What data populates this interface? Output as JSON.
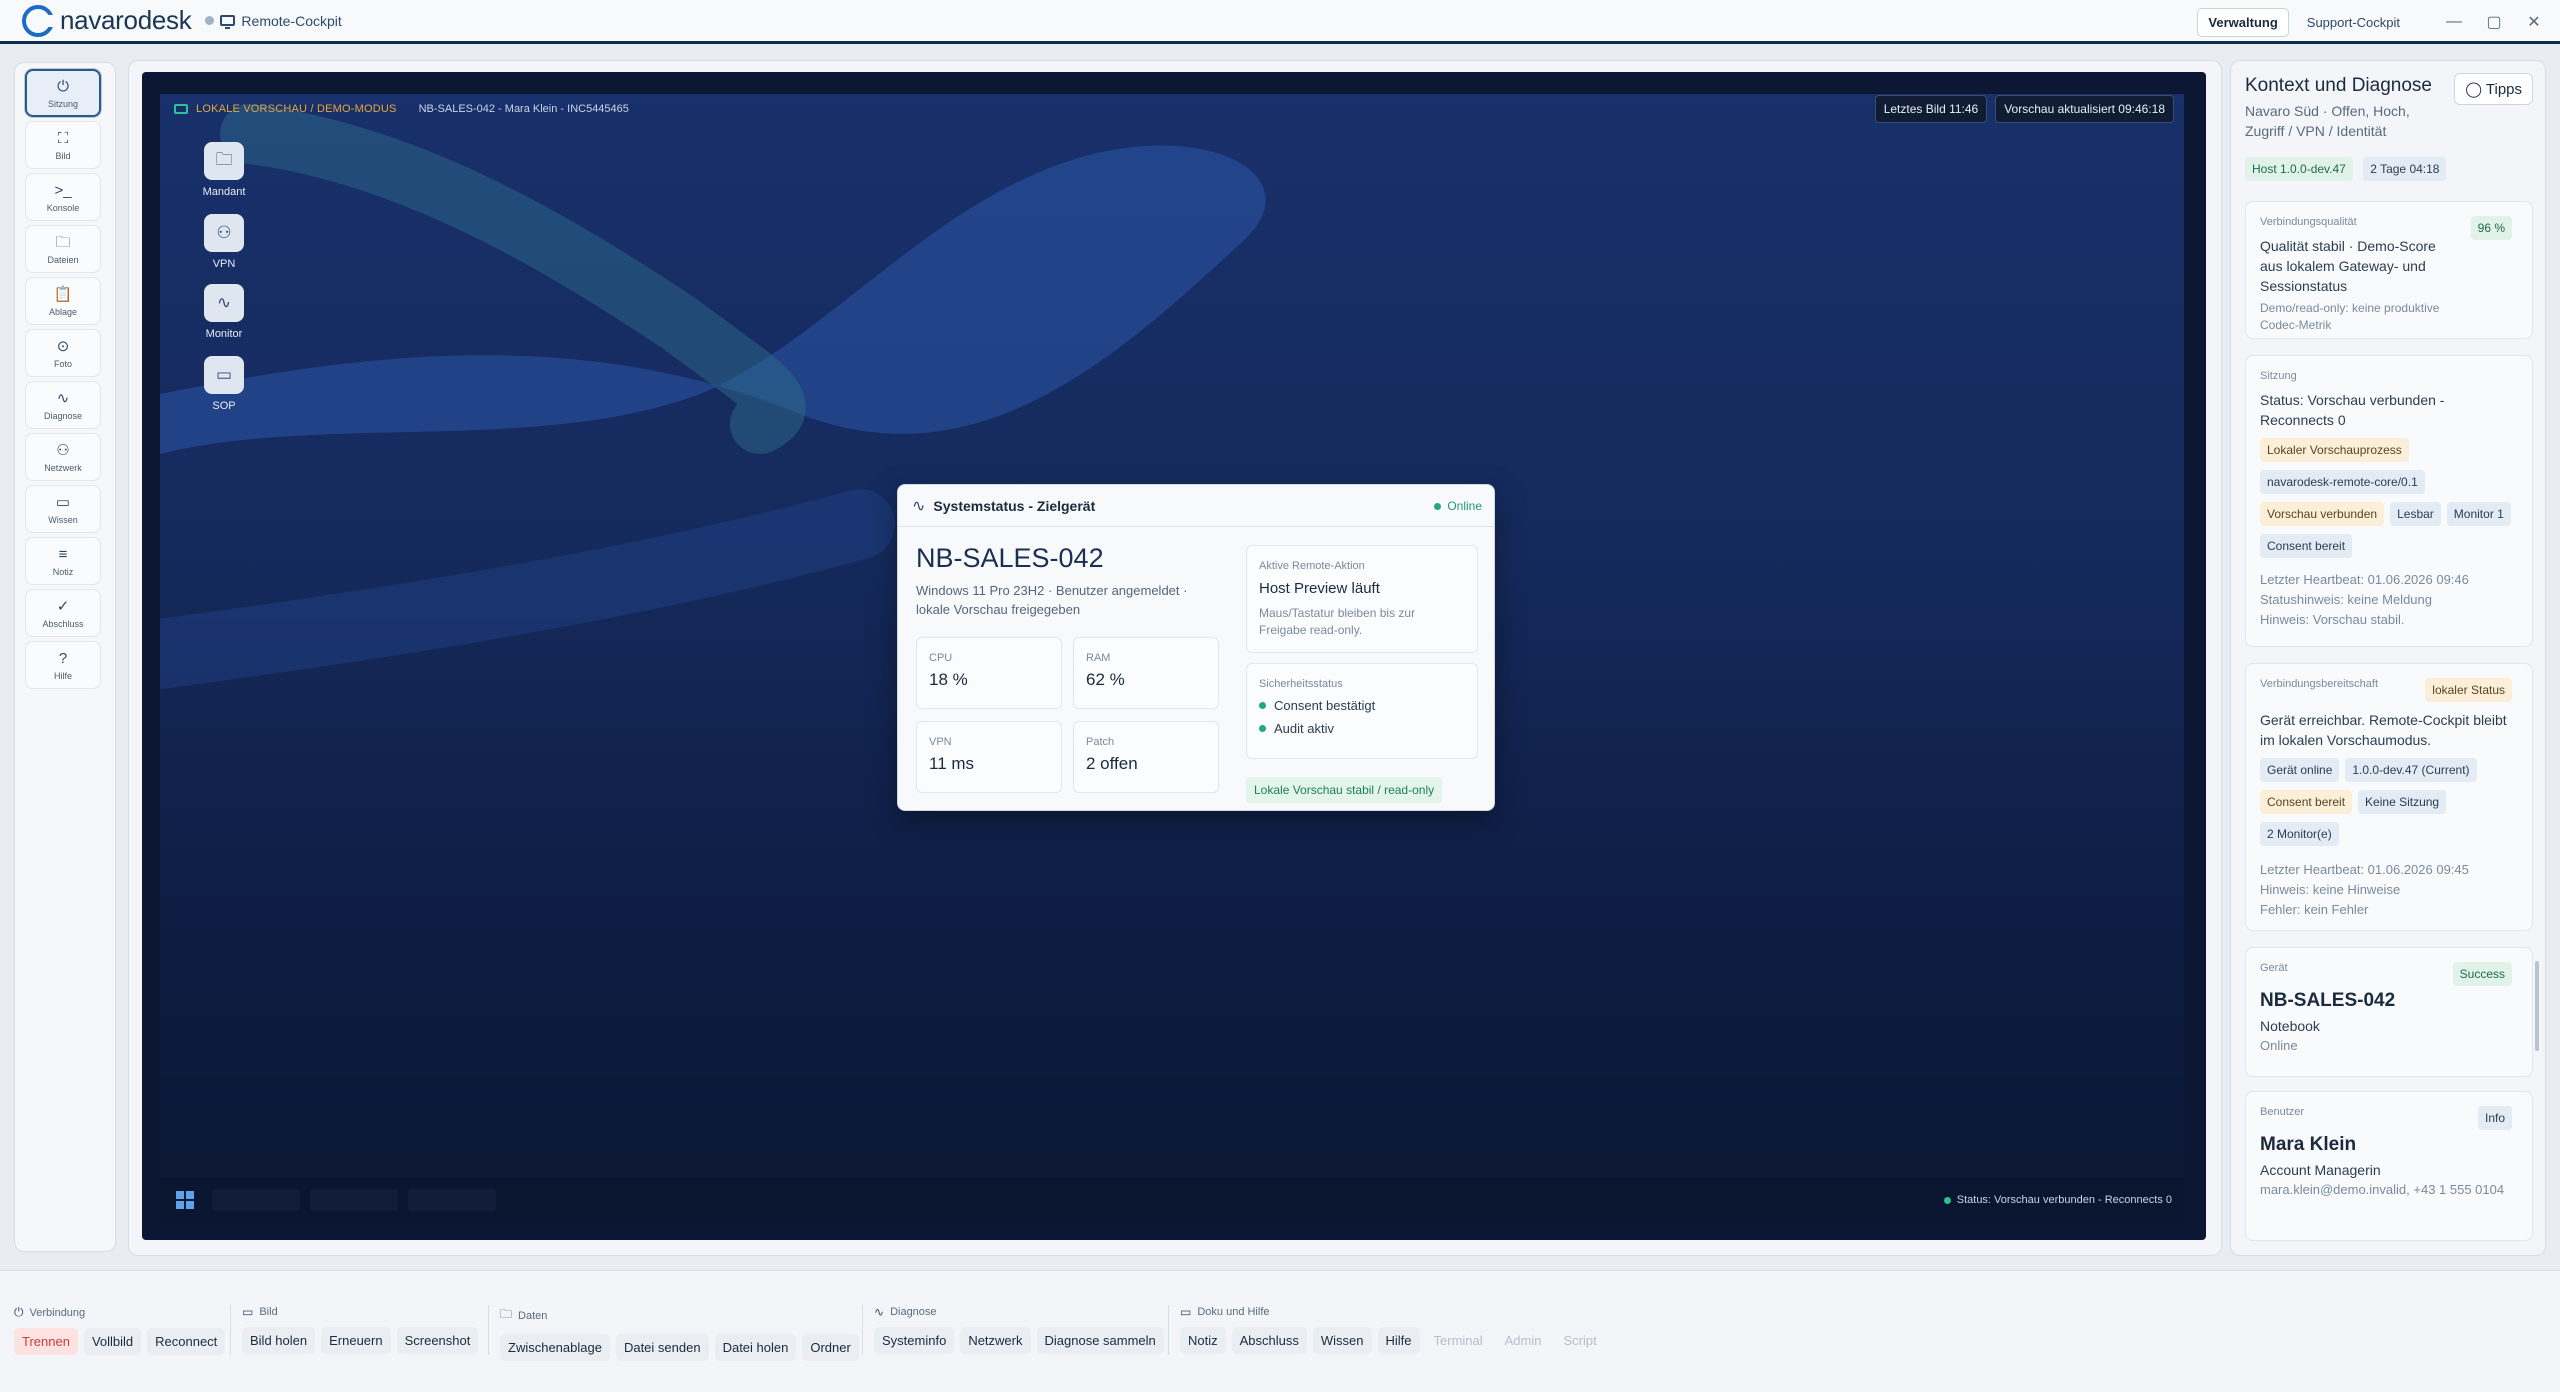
{
  "app": {
    "brand": "navarodesk",
    "mode": "Remote-Cockpit",
    "tabs": [
      "Verwaltung",
      "Support-Cockpit"
    ],
    "active_tab": "Verwaltung",
    "win": {
      "min": "—",
      "max": "▢",
      "close": "✕"
    }
  },
  "sidebar": [
    {
      "label": "Sitzung",
      "icon": "⏻",
      "name": "power-icon"
    },
    {
      "label": "Bild",
      "icon": "⛶",
      "name": "fullscreen-icon"
    },
    {
      "label": "Konsole",
      "icon": ">_",
      "name": "terminal-icon"
    },
    {
      "label": "Dateien",
      "icon": "🗀",
      "name": "folder-icon"
    },
    {
      "label": "Ablage",
      "icon": "📋",
      "name": "clipboard-icon"
    },
    {
      "label": "Foto",
      "icon": "⊙",
      "name": "camera-icon"
    },
    {
      "label": "Diagnose",
      "icon": "∿",
      "name": "activity-icon"
    },
    {
      "label": "Netzwerk",
      "icon": "⚇",
      "name": "network-icon"
    },
    {
      "label": "Wissen",
      "icon": "▭",
      "name": "book-icon"
    },
    {
      "label": "Notiz",
      "icon": "≡",
      "name": "note-icon"
    },
    {
      "label": "Abschluss",
      "icon": "✓",
      "name": "check-circle-icon"
    },
    {
      "label": "Hilfe",
      "icon": "?",
      "name": "help-icon"
    }
  ],
  "desk": {
    "demo_label": "LOKALE VORSCHAU / DEMO-MODUS",
    "session_id": "NB-SALES-042 - Mara Klein - INC5445465",
    "last_frame": "Letztes Bild 11:46",
    "updated": "Vorschau aktualisiert 09:46:18",
    "icons": [
      {
        "label": "Mandant",
        "icon": "🗀"
      },
      {
        "label": "VPN",
        "icon": "⚇"
      },
      {
        "label": "Monitor",
        "icon": "∿"
      },
      {
        "label": "SOP",
        "icon": "▭"
      }
    ],
    "taskbar_status": "Status: Vorschau verbunden - Reconnects 0"
  },
  "card": {
    "title": "Systemstatus - Zielgerät",
    "online": "Online",
    "device": "NB-SALES-042",
    "subtitle": "Windows 11 Pro 23H2 · Benutzer angemeldet · lokale Vorschau freigegeben",
    "metrics": [
      {
        "k": "CPU",
        "v": "18 %"
      },
      {
        "k": "RAM",
        "v": "62 %"
      },
      {
        "k": "VPN",
        "v": "11 ms"
      },
      {
        "k": "Patch",
        "v": "2 offen"
      }
    ],
    "action": {
      "k": "Aktive Remote-Aktion",
      "title": "Host Preview läuft",
      "note": "Maus/Tastatur bleiben bis zur Freigabe read-only."
    },
    "security": {
      "k": "Sicherheitsstatus",
      "items": [
        "Consent bestätigt",
        "Audit aktiv"
      ]
    },
    "stable": "Lokale Vorschau stabil / read-only"
  },
  "right": {
    "title": "Kontext und Diagnose",
    "tips": "Tipps",
    "sub": "Navaro Süd · Offen, Hoch, Zugriff / VPN / Identität",
    "top_chips": [
      "Host 1.0.0-dev.47",
      "2 Tage 04:18"
    ],
    "quality": {
      "k": "Verbindungsqualität",
      "badge": "96 %",
      "txt": "Qualität stabil · Demo-Score aus lokalem Gateway- und Sessionstatus",
      "muted": "Demo/read-only: keine produktive Codec-Metrik"
    },
    "session": {
      "k": "Sitzung",
      "txt": "Status: Vorschau verbunden - Reconnects 0",
      "chips": [
        [
          "Lokaler Vorschauprozess",
          "amber"
        ],
        [
          "navarodesk-remote-core/0.1",
          "blue"
        ],
        [
          "Vorschau verbunden",
          "amber"
        ],
        [
          "Lesbar",
          "blue"
        ],
        [
          "Monitor 1",
          "blue"
        ],
        [
          "Consent bereit",
          "blue"
        ]
      ],
      "lines": [
        "Letzter Heartbeat: 01.06.2026 09:46",
        "Statushinweis: keine Meldung",
        "Hinweis: Vorschau stabil."
      ]
    },
    "ready": {
      "k": "Verbindungsbereitschaft",
      "badge": "lokaler Status",
      "txt": "Gerät erreichbar. Remote-Cockpit bleibt im lokalen Vorschaumodus.",
      "chips": [
        [
          "Gerät online",
          "blue"
        ],
        [
          "1.0.0-dev.47 (Current)",
          "blue"
        ],
        [
          "Consent bereit",
          "amber"
        ],
        [
          "Keine Sitzung",
          "blue"
        ],
        [
          "2 Monitor(e)",
          "blue"
        ]
      ],
      "lines": [
        "Letzter Heartbeat: 01.06.2026 09:45",
        "Hinweis: keine Hinweise",
        "Fehler: kein Fehler"
      ]
    },
    "device": {
      "k": "Gerät",
      "badge": "Success",
      "name": "NB-SALES-042",
      "type": "Notebook",
      "status": "Online"
    },
    "user": {
      "k": "Benutzer",
      "badge": "Info",
      "name": "Mara Klein",
      "role": "Account Managerin",
      "contact": "mara.klein@demo.invalid, +43 1 555 0104"
    }
  },
  "bottom": [
    {
      "h": "Verbindung",
      "icon": "⏻",
      "btns": [
        [
          "Trennen",
          "red"
        ],
        [
          "Vollbild",
          ""
        ],
        [
          "Reconnect",
          ""
        ]
      ]
    },
    {
      "h": "Bild",
      "icon": "▭",
      "btns": [
        [
          "Bild holen",
          ""
        ],
        [
          "Erneuern",
          ""
        ],
        [
          "Screenshot",
          ""
        ]
      ]
    },
    {
      "h": "Daten",
      "icon": "🗀",
      "btns": [
        [
          "Zwischenablage",
          ""
        ],
        [
          "Datei senden",
          ""
        ],
        [
          "Datei holen",
          ""
        ],
        [
          "Ordner",
          ""
        ]
      ]
    },
    {
      "h": "Diagnose",
      "icon": "∿",
      "btns": [
        [
          "Systeminfo",
          ""
        ],
        [
          "Netzwerk",
          ""
        ],
        [
          "Diagnose sammeln",
          ""
        ]
      ]
    },
    {
      "h": "Doku und Hilfe",
      "icon": "▭",
      "btns": [
        [
          "Notiz",
          ""
        ],
        [
          "Abschluss",
          ""
        ],
        [
          "Wissen",
          ""
        ],
        [
          "Hilfe",
          ""
        ],
        [
          "Terminal",
          "dis"
        ],
        [
          "Admin",
          "dis"
        ],
        [
          "Script",
          "dis"
        ]
      ]
    }
  ]
}
